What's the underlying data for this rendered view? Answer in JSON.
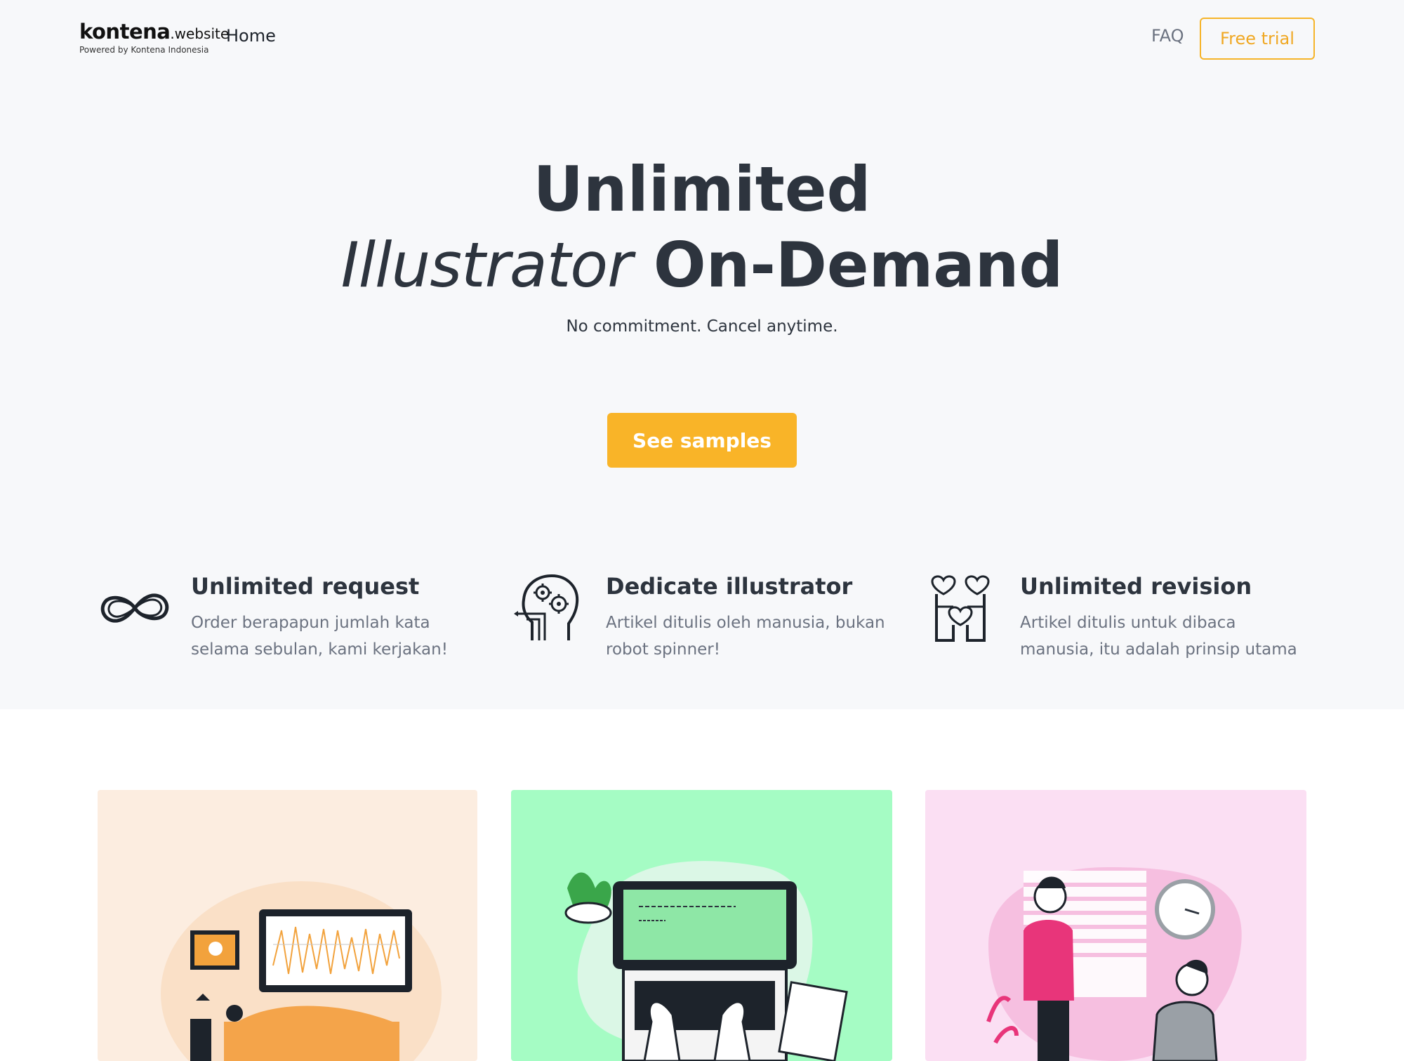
{
  "header": {
    "logo_main": "kontena",
    "logo_suffix": ".website",
    "logo_sub": "Powered by Kontena Indonesia",
    "nav_home": "Home",
    "nav_faq": "FAQ",
    "free_trial": "Free trial"
  },
  "hero": {
    "title_line1": "Unlimited",
    "title_script": "Illustrator",
    "title_rest": " On-Demand",
    "subtitle": "No commitment. Cancel anytime.",
    "cta": "See samples"
  },
  "features": [
    {
      "icon": "infinity-icon",
      "title": "Unlimited request",
      "desc": "Order berapapun jumlah kata selama sebulan, kami kerjakan!"
    },
    {
      "icon": "brain-head-icon",
      "title": "Dedicate illustrator",
      "desc": "Artikel ditulis oleh manusia, bukan robot spinner!"
    },
    {
      "icon": "hearts-hands-icon",
      "title": "Unlimited revision",
      "desc": "Artikel ditulis untuk dibaca manusia, itu adalah prinsip utama"
    }
  ],
  "colors": {
    "accent": "#f9b428",
    "hero_bg": "#f7f8fa",
    "card1_bg": "#fcede0",
    "card2_bg": "#a5fcc4",
    "card3_bg": "#fbdff3",
    "heading": "#2d343e",
    "muted": "#6b7280"
  },
  "cards": [
    {
      "illustration": "sleeping-person-with-monitor-chart-illustration"
    },
    {
      "illustration": "laptop-typing-hands-illustration"
    },
    {
      "illustration": "shocked-people-illustration"
    }
  ]
}
